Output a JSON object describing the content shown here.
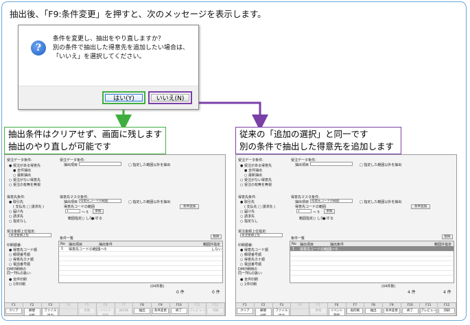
{
  "headline": "抽出後、「F9:条件変更」を押すと、次のメッセージを表示します。",
  "dialog": {
    "message": "条件を変更し、抽出をやり直しますか？\n別の条件で抽出した得意先を追加したい場合は、\n「いいえ」を選択してください。",
    "yes_label": "はい(Y)",
    "no_label": "いいえ(N)"
  },
  "colors": {
    "yes_path": "#3fae3f",
    "no_path": "#7b3fa8",
    "frame": "#6aa6d8"
  },
  "callout_yes": "抽出条件はクリアせず、画面に残します\n抽出のやり直しが可能です",
  "callout_no": "従来の「追加の選択」と同一です\n別の条件で抽出した得意先を追加します",
  "screens": [
    {
      "id": "left",
      "grid_row1_no": "1",
      "grid_row1_item": "得意先コードの範囲",
      "grid_row1_cond": "1～5",
      "grid_row1_flag": "しない",
      "grid_row1_highlight": false,
      "count_label": "(04件数)",
      "count_value": "0 件",
      "total_value": "0 件",
      "keys_dim": [
        false,
        false,
        false,
        true,
        true,
        true,
        true,
        false,
        false,
        false,
        true,
        true
      ]
    },
    {
      "id": "right",
      "grid_row1_no": "1",
      "grid_row1_item": "得意先コードの範囲",
      "grid_row1_cond": "1～5",
      "grid_row1_flag": "",
      "grid_row1_highlight": true,
      "count_label": "(04件数)",
      "count_value": "4 件",
      "total_value": "4 件",
      "keys_dim": [
        false,
        false,
        false,
        true,
        true,
        false,
        false,
        false,
        false,
        false,
        false,
        false
      ]
    }
  ],
  "screen_labels": {
    "data_cond": "受注データ条件:",
    "radio1": "受注がある得意先",
    "radio1a": "全件抽出",
    "radio1b": "最新抽出",
    "radio2": "受注がない得意先",
    "radio3": "受注の有無を無視",
    "extract_item": "抽出項目",
    "range_check": "□ 指定した範囲以外を抽出",
    "cust_cond": "得意先条件:",
    "c1": "取引先",
    "c1sub": "( 支払先 □ 請求先 )",
    "c2": "届け先",
    "c3": "請求先",
    "c4": "指定なし",
    "master_cond": "得意先マスタ条件:",
    "master_item": "抽出項目",
    "master_value": "得意先コードの範囲",
    "code_range": "得意先コードの範囲",
    "from": "1",
    "to": "～ 5",
    "ref": "参照",
    "add_cond": "条件追加",
    "range_spec": "範囲指定",
    "no": "しない",
    "yes": "する",
    "amount_cond": "受注金額上位指定:",
    "amount_item": "受注金額上位",
    "cond_list": "条件一覧",
    "delete": "削除",
    "col_no": "No",
    "col_item": "抽出項目",
    "col_cond": "抽出条件",
    "col_flag": "範囲外指定",
    "print_order": "印刷順番:",
    "p1": "得意先コード順",
    "p2": "郵便番号順",
    "p3": "得意先カナ順",
    "p4": "電話番号順",
    "dm_label": "DM印刷時の\n同一TELの扱い:",
    "dm1": "全件印刷",
    "dm2": "1件印刷",
    "fkeys": [
      {
        "key": "F1",
        "label": "クリア"
      },
      {
        "key": "F2",
        "label": "郵便\n分析"
      },
      {
        "key": "F3",
        "label": "ファイル\n出力"
      },
      {
        "key": "F4",
        "label": ""
      },
      {
        "key": "F5",
        "label": "参照"
      },
      {
        "key": "F6",
        "label": "イベント\n登録"
      },
      {
        "key": "F7",
        "label": "再印刷"
      },
      {
        "key": "F8",
        "label": "抽出"
      },
      {
        "key": "F9",
        "label": "条件変更"
      },
      {
        "key": "F10",
        "label": "終了"
      },
      {
        "key": "F11",
        "label": "プレビュー"
      },
      {
        "key": "F12",
        "label": "印刷"
      }
    ]
  }
}
